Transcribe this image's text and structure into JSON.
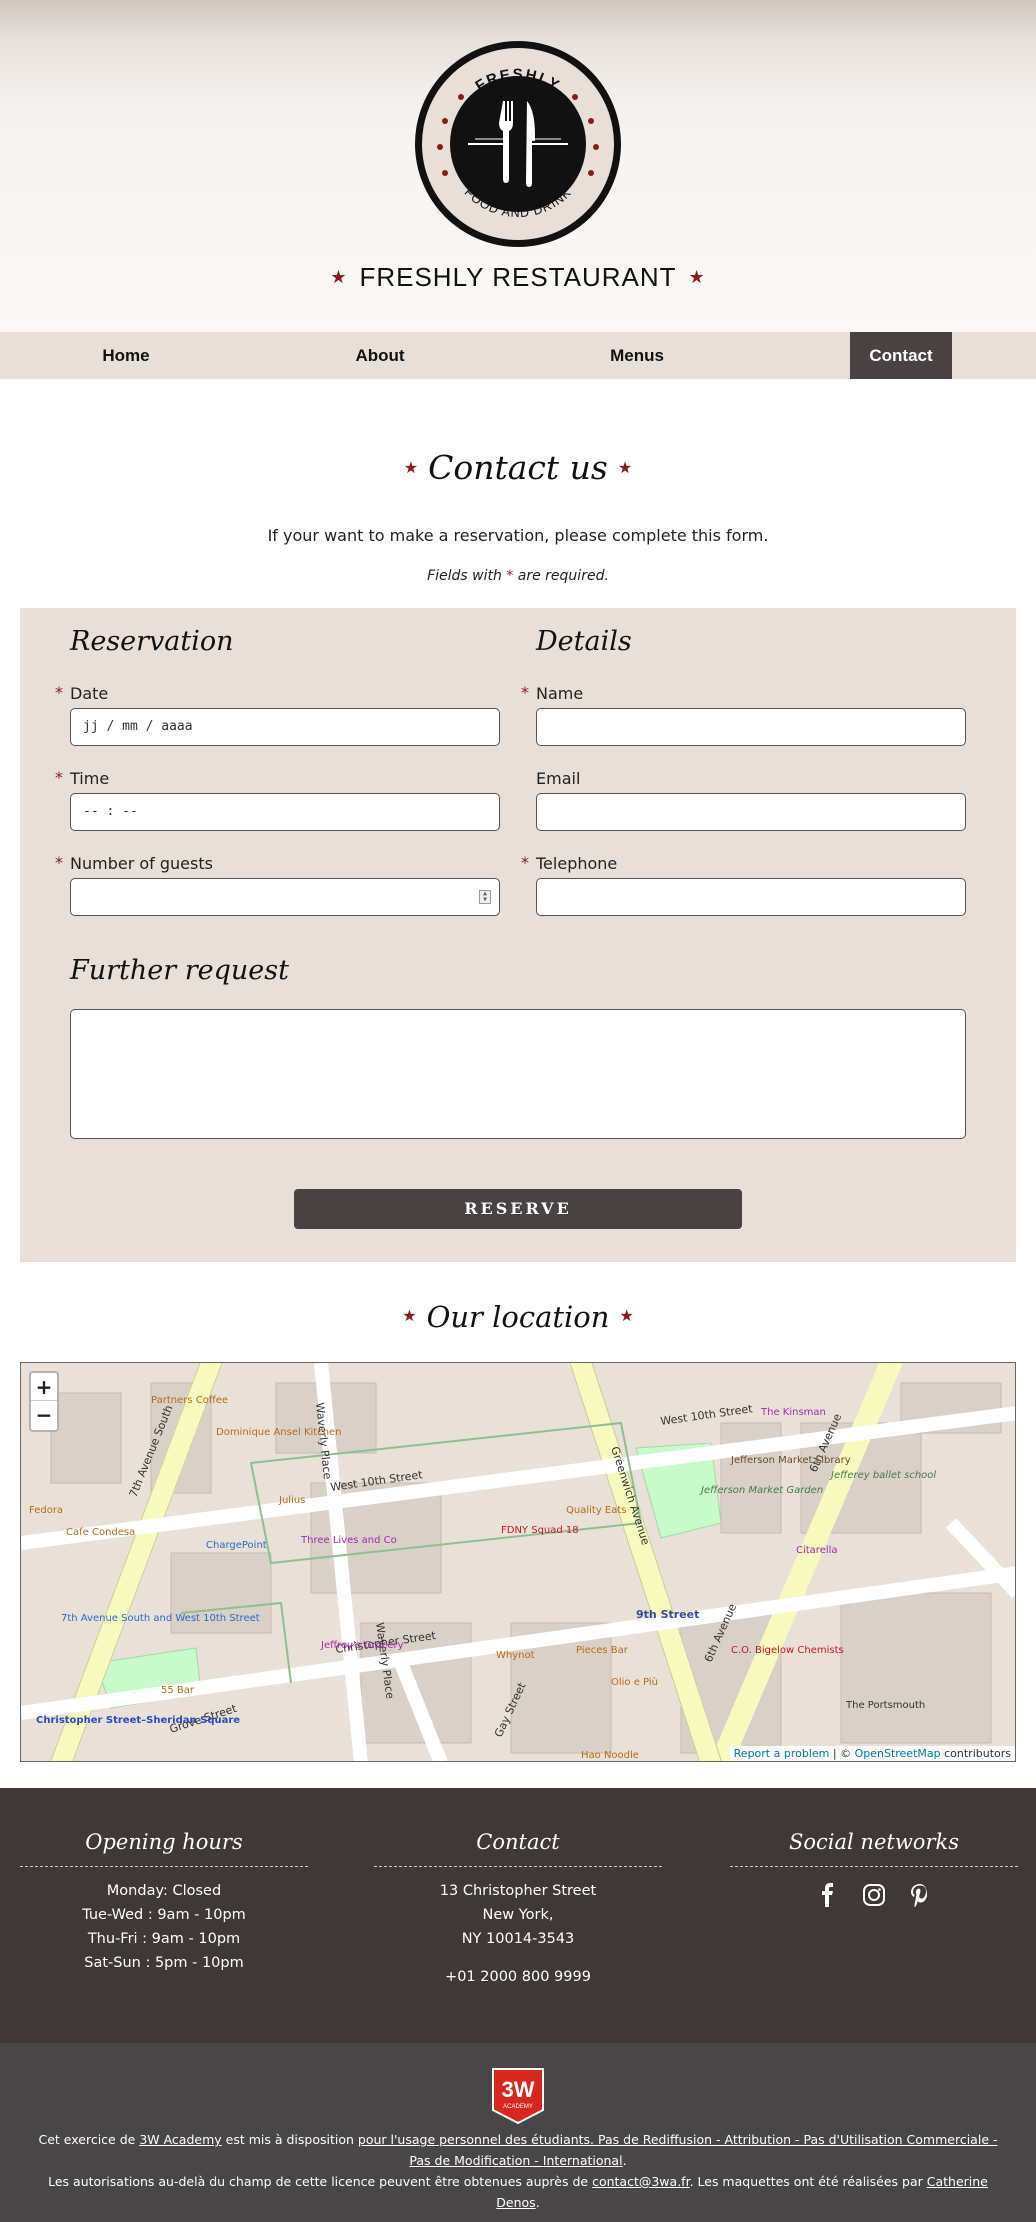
{
  "brand": {
    "logo_top_text": "FRESHLY",
    "logo_bottom_text": "FOOD AND DRINK",
    "name": "FRESHLY RESTAURANT",
    "star": "★",
    "accent_color": "#8b1a1a"
  },
  "nav": {
    "items": [
      {
        "label": "Home"
      },
      {
        "label": "About"
      },
      {
        "label": "Menus"
      },
      {
        "label": "Contact",
        "active": true
      }
    ]
  },
  "contact": {
    "title": "Contact us",
    "intro": "If your want to make a reservation, please complete this form.",
    "required_note_pre": "Fields with",
    "required_mark": "*",
    "required_note_post": "are required."
  },
  "form": {
    "reservation_heading": "Reservation",
    "details_heading": "Details",
    "further_heading": "Further request",
    "fields": {
      "date": {
        "label": "Date",
        "placeholder": "jj / mm / aaaa",
        "required": true
      },
      "time": {
        "label": "Time",
        "placeholder": "-- : --",
        "required": true
      },
      "guests": {
        "label": "Number of guests",
        "value": "",
        "required": true
      },
      "name": {
        "label": "Name",
        "value": "",
        "required": true
      },
      "email": {
        "label": "Email",
        "value": "",
        "required": false
      },
      "telephone": {
        "label": "Telephone",
        "value": "",
        "required": true
      }
    },
    "submit_label": "RESERVE"
  },
  "location": {
    "title": "Our location",
    "zoom_in": "+",
    "zoom_out": "−",
    "attribution_link": "Report a problem",
    "attribution_sep": " | © ",
    "attribution_osm": "OpenStreetMap",
    "attribution_tail": " contributors",
    "streets": [
      "West 10th Street",
      "Christopher Street",
      "Waverly Place",
      "Greenwich Avenue",
      "6th Avenue",
      "7th Avenue South",
      "Grove Street",
      "Gay Street",
      "9th Street"
    ],
    "places": [
      "Jefferson Market Garden",
      "Jefferson Market Library",
      "The Portsmouth",
      "C.O. Bigelow Chemists",
      "Citarella",
      "The Kinsman",
      "Dominique Ansel Kitchen",
      "Partners Coffee",
      "ChargePoint",
      "Three Lives and Co",
      "Jeffrey's Grocery",
      "FDNY Squad 18",
      "Quality Eats",
      "Pieces Bar",
      "Olio e Più",
      "Whynot",
      "Hao Noodle",
      "Julius",
      "Cafe Condesa",
      "Fedora",
      "55 Bar",
      "Christopher Street–Sheridan Square",
      "7th Avenue South and West 10th Street",
      "Jefferey ballet school"
    ]
  },
  "footer": {
    "hours": {
      "title": "Opening hours",
      "lines": [
        "Monday: Closed",
        "Tue-Wed : 9am - 10pm",
        "Thu-Fri : 9am - 10pm",
        "Sat-Sun : 5pm - 10pm"
      ]
    },
    "contact": {
      "title": "Contact",
      "lines": [
        "13 Christopher Street",
        "New York,",
        "NY 10014-3543"
      ],
      "phone": "+01 2000 800 9999"
    },
    "social": {
      "title": "Social networks",
      "icons": [
        "facebook-icon",
        "instagram-icon",
        "pinterest-icon"
      ]
    }
  },
  "credits": {
    "badge_text": "3W",
    "badge_sub": "ACADEMY",
    "line1_a": "Cet exercice de ",
    "line1_link1": "3W Academy",
    "line1_b": " est mis à disposition ",
    "line1_link2": "pour l'usage personnel des étudiants. Pas de Rediffusion - Attribution - Pas d'Utilisation Commerciale - Pas de Modification - International",
    "line1_end": ".",
    "line2_a": "Les autorisations au-delà du champ de cette licence peuvent être obtenues auprès de ",
    "line2_link1": "contact@3wa.fr",
    "line2_b": ". Les maquettes ont été réalisées par ",
    "line2_link2": "Catherine Denos",
    "line2_end": "."
  }
}
